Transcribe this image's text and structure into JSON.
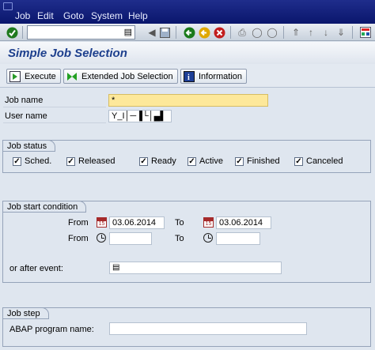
{
  "menu": [
    "Job",
    "Edit",
    "Goto",
    "System",
    "Help"
  ],
  "toolbar": {
    "command_field_value": "",
    "icons": [
      "enter-icon",
      "back-icon",
      "exit-icon",
      "cancel-icon",
      "print-icon",
      "find-icon",
      "find-next-icon",
      "first-page-icon",
      "previous-page-icon",
      "next-page-icon",
      "last-page-icon",
      "layout-menu-icon"
    ]
  },
  "title": "Simple Job Selection",
  "app_toolbar": {
    "execute": "Execute",
    "extended": "Extended Job Selection",
    "information": "Information"
  },
  "fields": {
    "job_name_label": "Job name",
    "job_name_value": "*",
    "user_name_label": "User name",
    "user_name_value": "Y_I│─▐└│▄▌"
  },
  "job_status": {
    "title": "Job status",
    "items": [
      {
        "label": "Sched.",
        "checked": true
      },
      {
        "label": "Released",
        "checked": true
      },
      {
        "label": "Ready",
        "checked": true
      },
      {
        "label": "Active",
        "checked": true
      },
      {
        "label": "Finished",
        "checked": true
      },
      {
        "label": "Canceled",
        "checked": true
      }
    ]
  },
  "job_start": {
    "title": "Job start condition",
    "from_label": "From",
    "to_label": "To",
    "from_date": "03.06.2014",
    "to_date": "03.06.2014",
    "from_time": "",
    "to_time": "",
    "event_label": "or after event:",
    "event_value": ""
  },
  "job_step": {
    "title": "Job step",
    "abap_label": "ABAP program name:",
    "abap_value": ""
  },
  "colors": {
    "menubar": "#0a166c",
    "required_field": "#fde89a",
    "title_text": "#1d3f8d"
  }
}
